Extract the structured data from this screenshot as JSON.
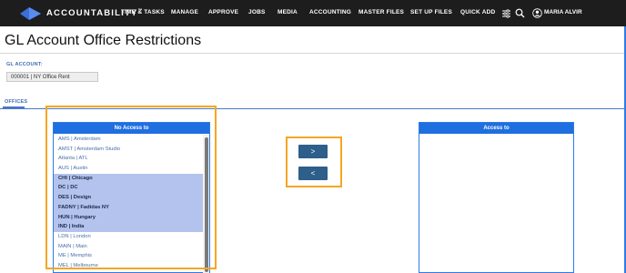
{
  "app": {
    "brand": "ACCOUNTABILITY",
    "brand_mark": "™"
  },
  "nav": {
    "items": [
      "TIME & TASKS",
      "MANAGE",
      "APPROVE",
      "JOBS",
      "MEDIA",
      "ACCOUNTING",
      "MASTER FILES",
      "SET UP FILES",
      "QUICK ADD"
    ],
    "user_name": "MARIA ALVIR"
  },
  "page": {
    "title": "GL Account Office Restrictions"
  },
  "gl_account": {
    "label": "GL ACCOUNT:",
    "value": "000001 | NY Office Rent"
  },
  "offices": {
    "label": "OFFICES",
    "no_access_header": "No Access to",
    "access_header": "Access to",
    "no_access_items": [
      {
        "label": "AMS | Amsterdam",
        "selected": false
      },
      {
        "label": "AMST | Amsterdam Studio",
        "selected": false
      },
      {
        "label": "Atlanta | ATL",
        "selected": false
      },
      {
        "label": "AUS | Austin",
        "selected": false
      },
      {
        "label": "CHI | Chicago",
        "selected": true
      },
      {
        "label": "DC | DC",
        "selected": true
      },
      {
        "label": "DES | Design",
        "selected": true
      },
      {
        "label": "FADNY | Fadidas NY",
        "selected": true
      },
      {
        "label": "HUN | Hungary",
        "selected": true
      },
      {
        "label": "IND | India",
        "selected": true
      },
      {
        "label": "LDN | London",
        "selected": false
      },
      {
        "label": "MAIN | Main",
        "selected": false
      },
      {
        "label": "ME | Memphis",
        "selected": false
      },
      {
        "label": "MEL | Melbourne",
        "selected": false
      }
    ],
    "access_items": []
  },
  "buttons": {
    "move_right": ">",
    "move_left": "<"
  },
  "colors": {
    "topbar": "#1d1d1d",
    "header_blue": "#1f6fe0",
    "selected_row": "#b3c3ee",
    "button": "#2d5f8a",
    "annotation": "#f5a623"
  },
  "icons": [
    "accountability-logo-icon",
    "filter-icon",
    "search-icon",
    "user-icon"
  ]
}
